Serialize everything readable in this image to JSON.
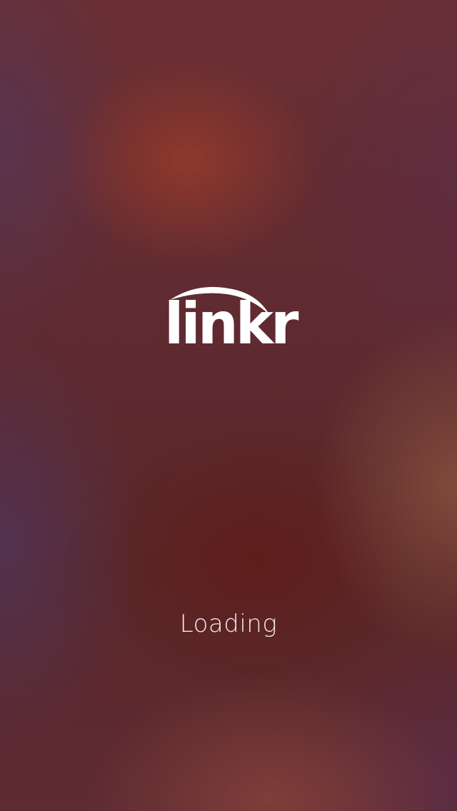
{
  "app": {
    "logo_text": "linkr",
    "loading_label": "Loading"
  },
  "colors": {
    "text": "#ffffff",
    "background_base": "#5c2a2f",
    "background_highlight": "#963a2a",
    "background_edge": "#50375f"
  },
  "icons": {
    "logo": "linkr-logo-arc"
  }
}
